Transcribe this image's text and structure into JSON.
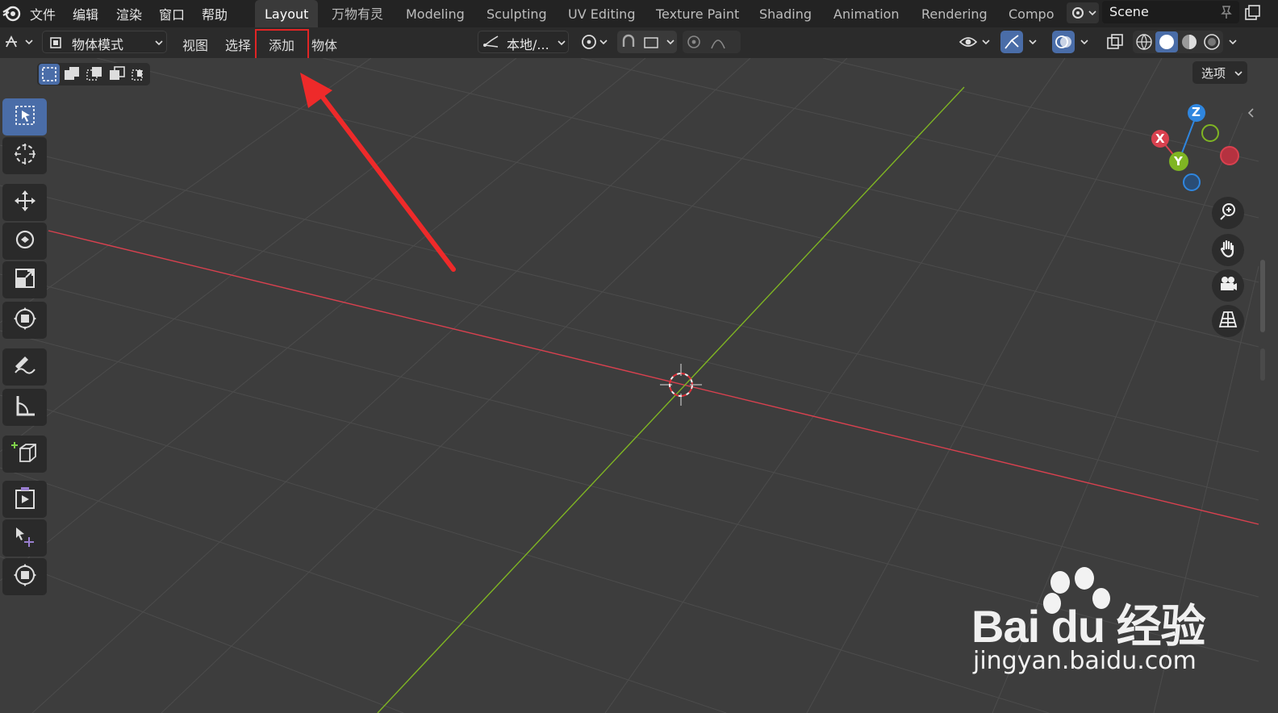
{
  "menu": {
    "file": "文件",
    "edit": "编辑",
    "render": "渲染",
    "window": "窗口",
    "help": "帮助"
  },
  "workspace_tabs": [
    "Layout",
    "万物有灵",
    "Modeling",
    "Sculpting",
    "UV Editing",
    "Texture Paint",
    "Shading",
    "Animation",
    "Rendering",
    "Compo"
  ],
  "active_tab": "Layout",
  "scene": {
    "name": "Scene"
  },
  "header": {
    "mode": "物体模式",
    "view": "视图",
    "select": "选择",
    "add": "添加",
    "object": "物体",
    "transform_orientation": "本地/...",
    "options": "选项"
  },
  "gizmo": {
    "x": "X",
    "y": "Y",
    "z": "Z"
  },
  "colors": {
    "accent": "#4a6da8",
    "x_axis": "#d9414f",
    "y_axis": "#7fb523",
    "z_axis": "#2f86df",
    "highlight_box": "#e02525"
  },
  "watermark": {
    "logo": "Bai du 经验",
    "url": "jingyan.baidu.com"
  }
}
